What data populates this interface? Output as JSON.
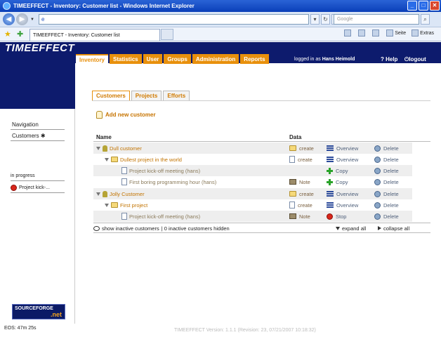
{
  "window": {
    "title": "TIMEEFFECT - Inventory: Customer list - Windows Internet Explorer",
    "minimize": "_",
    "maximize": "□",
    "close": "✕"
  },
  "browser": {
    "address_value": "e",
    "search_placeholder": "Google",
    "tab_title": "TIMEEFFECT - Inventory: Customer list",
    "cmd_page": "Seite",
    "cmd_extras": "Extras"
  },
  "app": {
    "logo": "TIMEEFFECT",
    "menu": [
      {
        "label": "Inventory",
        "active": true
      },
      {
        "label": "Statistics"
      },
      {
        "label": "User"
      },
      {
        "label": "Groups"
      },
      {
        "label": "Administration"
      },
      {
        "label": "Reports"
      }
    ],
    "logged_in_prefix": "logged in as",
    "logged_in_user": "Hans Heimold",
    "help": "Help",
    "logout": "logout"
  },
  "sidebar": {
    "navigation_title": "Navigation",
    "customers": "Customers",
    "in_progress_title": "in progress",
    "in_progress_item": "Project kick-...",
    "sf_logo": "SOURCEFORGE",
    "sf_logo_suffix": ".net",
    "eos": "EOS: 47m 25s"
  },
  "main": {
    "subtabs": [
      {
        "label": "Customers",
        "active": true
      },
      {
        "label": "Projects"
      },
      {
        "label": "Efforts"
      }
    ],
    "add_customer": "Add new customer",
    "col_name": "Name",
    "col_data": "Data",
    "rows": [
      {
        "name": "Dull customer",
        "kind": "customer",
        "a1": "create",
        "a2": "Overview",
        "a3": "Delete"
      },
      {
        "name": "Dullest project in the world",
        "kind": "project",
        "a1": "create",
        "a2": "Overview",
        "a3": "Delete"
      },
      {
        "name": "Project kick-off meeting (hans)",
        "kind": "effort",
        "a1": "",
        "a2": "Copy",
        "a3": "Delete"
      },
      {
        "name": "First boring programming hour (hans)",
        "kind": "effort",
        "a1": "Note",
        "a2": "Copy",
        "a3": "Delete"
      },
      {
        "name": "Jolly Customer",
        "kind": "customer",
        "a1": "create",
        "a2": "Overview",
        "a3": "Delete"
      },
      {
        "name": "First project",
        "kind": "project",
        "a1": "create",
        "a2": "Overview",
        "a3": "Delete"
      },
      {
        "name": "Project kick-off meeting (hans)",
        "kind": "effort",
        "a1": "Note",
        "a2": "Stop",
        "a3": "Delete"
      }
    ],
    "show_inactive": "show inactive customers",
    "inactive_hidden": "| 0 inactive customers hidden",
    "expand_all": "expand all",
    "collapse_all": "collapse all"
  },
  "footer": {
    "version": "TIMEEFFECT Version: 1.1.1 (Revision: 23, 07/21/2007 10:18:32)"
  }
}
